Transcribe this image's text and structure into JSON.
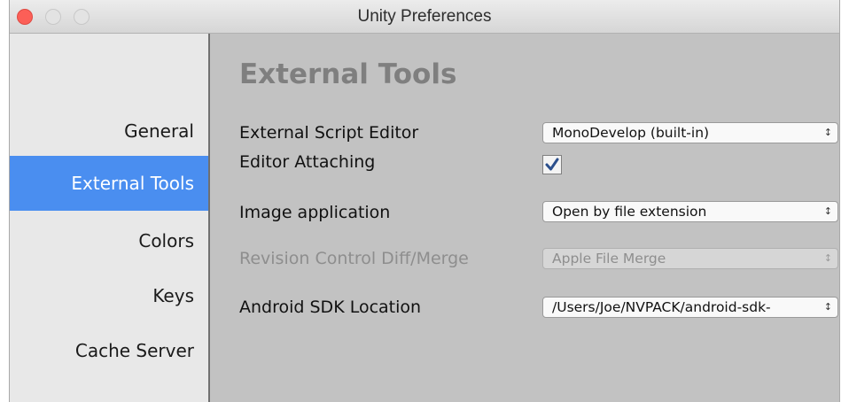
{
  "window": {
    "title": "Unity Preferences"
  },
  "sidebar": {
    "items": [
      {
        "label": "General",
        "selected": false
      },
      {
        "label": "External Tools",
        "selected": true
      },
      {
        "label": "Colors",
        "selected": false
      },
      {
        "label": "Keys",
        "selected": false
      },
      {
        "label": "Cache Server",
        "selected": false
      }
    ]
  },
  "main": {
    "heading": "External Tools",
    "script_editor": {
      "label": "External Script Editor",
      "value": "MonoDevelop (built-in)"
    },
    "editor_attaching": {
      "label": "Editor Attaching",
      "checked": true
    },
    "image_app": {
      "label": "Image application",
      "value": "Open by file extension"
    },
    "revision_diff": {
      "label": "Revision Control Diff/Merge",
      "value": "Apple File Merge",
      "enabled": false
    },
    "android_sdk": {
      "label": "Android SDK Location",
      "value": "/Users/Joe/NVPACK/android-sdk-"
    }
  },
  "icons": {
    "popup_arrows": "up-down-arrows-icon",
    "check": "checkmark-icon"
  },
  "colors": {
    "selection": "#4a8ef0",
    "close_button": "#fc5f57",
    "content_bg": "#c2c2c2",
    "check_color": "#2b4f8c"
  }
}
